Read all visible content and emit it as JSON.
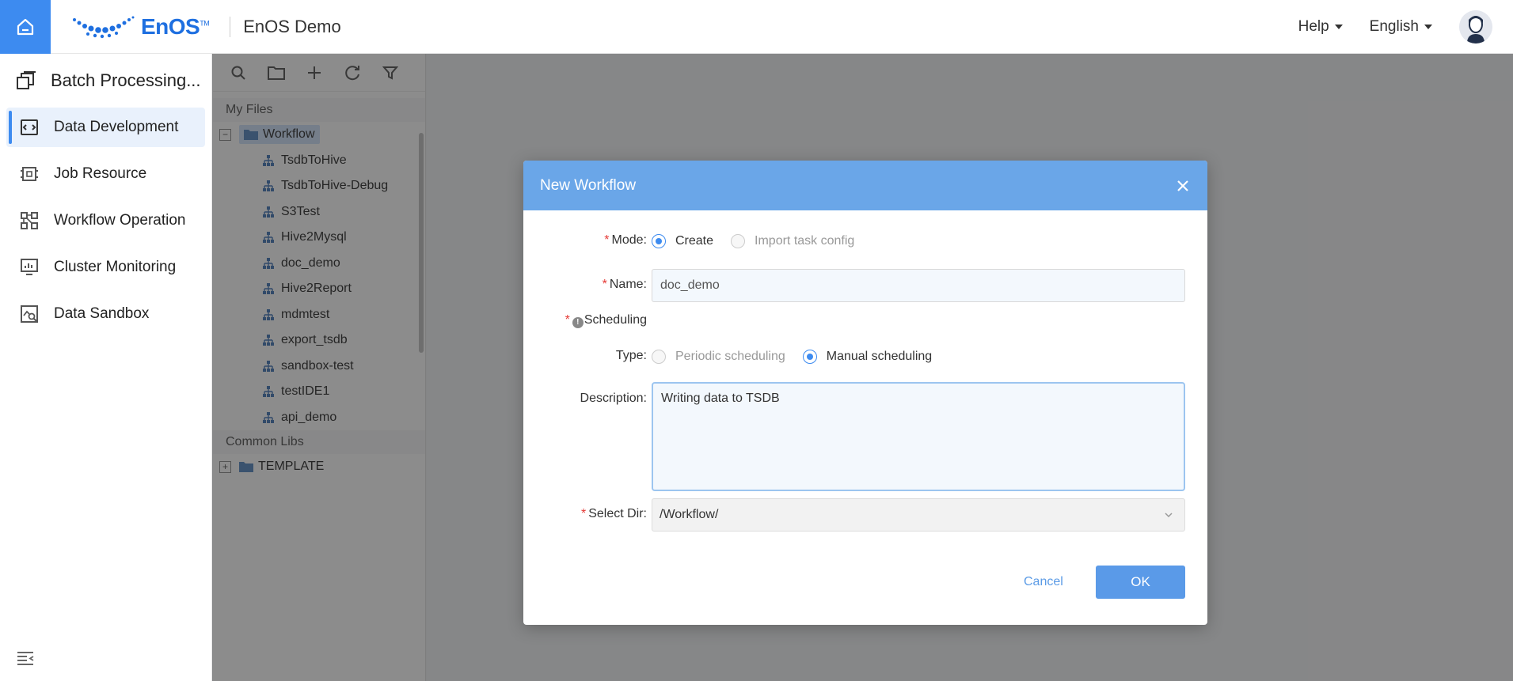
{
  "header": {
    "logo_text": "EnOS",
    "logo_tm": "TM",
    "app_title": "EnOS Demo",
    "help_label": "Help",
    "language_label": "English"
  },
  "sidenav": {
    "title": "Batch Processing...",
    "items": [
      {
        "label": "Data Development",
        "icon": "code-window-icon",
        "active": true
      },
      {
        "label": "Job Resource",
        "icon": "chip-icon",
        "active": false
      },
      {
        "label": "Workflow Operation",
        "icon": "workflow-icon",
        "active": false
      },
      {
        "label": "Cluster Monitoring",
        "icon": "monitor-icon",
        "active": false
      },
      {
        "label": "Data Sandbox",
        "icon": "sandbox-icon",
        "active": false
      }
    ]
  },
  "filetree": {
    "toolbar": [
      "search-icon",
      "folder-icon",
      "plus-icon",
      "refresh-icon",
      "filter-icon"
    ],
    "my_files_label": "My Files",
    "workflow_folder": "Workflow",
    "files": [
      "TsdbToHive",
      "TsdbToHive-Debug",
      "S3Test",
      "Hive2Mysql",
      "doc_demo",
      "Hive2Report",
      "mdmtest",
      "export_tsdb",
      "sandbox-test",
      "testIDE1",
      "api_demo"
    ],
    "common_libs_label": "Common Libs",
    "template_folder": "TEMPLATE"
  },
  "modal": {
    "title": "New Workflow",
    "mode_label": "Mode:",
    "mode_create": "Create",
    "mode_import": "Import task config",
    "name_label": "Name:",
    "name_value": "doc_demo",
    "scheduling_label": "Scheduling",
    "type_label": "Type:",
    "type_periodic": "Periodic scheduling",
    "type_manual": "Manual scheduling",
    "description_label": "Description:",
    "description_value": "Writing data to TSDB",
    "select_dir_label": "Select Dir:",
    "select_dir_value": "/Workflow/",
    "cancel_label": "Cancel",
    "ok_label": "OK"
  },
  "colors": {
    "primary": "#3d8bf0",
    "modal_header": "#6aa6e8",
    "required": "#e53935"
  }
}
